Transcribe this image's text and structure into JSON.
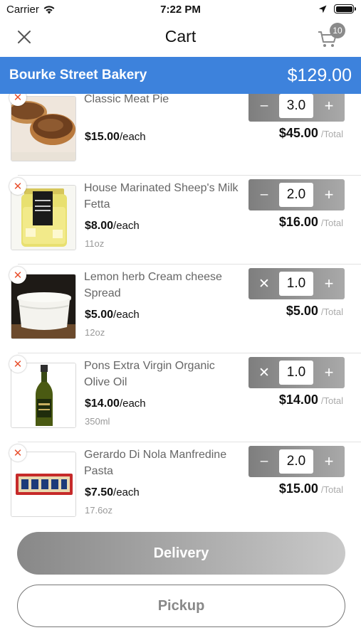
{
  "status_bar": {
    "carrier": "Carrier",
    "time": "7:22 PM"
  },
  "nav": {
    "title": "Cart",
    "cart_count": "10"
  },
  "store": {
    "name": "Bourke Street Bakery",
    "total": "$129.00"
  },
  "items": [
    {
      "name": "Classic Meat Pie",
      "price": "$15.00",
      "unit": "/each",
      "size": "",
      "qty": "3.0",
      "decrement_icon": "minus",
      "line_total": "$45.00",
      "total_label": "/Total",
      "image": "meat-pie"
    },
    {
      "name": "House Marinated Sheep's Milk Fetta",
      "price": "$8.00",
      "unit": "/each",
      "size": "11oz",
      "qty": "2.0",
      "decrement_icon": "minus",
      "line_total": "$16.00",
      "total_label": "/Total",
      "image": "fetta-jar"
    },
    {
      "name": "Lemon herb Cream cheese Spread",
      "price": "$5.00",
      "unit": "/each",
      "size": "12oz",
      "qty": "1.0",
      "decrement_icon": "remove",
      "line_total": "$5.00",
      "total_label": "/Total",
      "image": "cheese-tub"
    },
    {
      "name": "Pons Extra Virgin Organic Olive Oil",
      "price": "$14.00",
      "unit": "/each",
      "size": "350ml",
      "qty": "1.0",
      "decrement_icon": "remove",
      "line_total": "$14.00",
      "total_label": "/Total",
      "image": "olive-oil-bottle"
    },
    {
      "name": "Gerardo Di Nola Manfredine Pasta",
      "price": "$7.50",
      "unit": "/each",
      "size": "17.6oz",
      "qty": "2.0",
      "decrement_icon": "minus",
      "line_total": "$15.00",
      "total_label": "/Total",
      "image": "pasta-box"
    }
  ],
  "buttons": {
    "delivery": "Delivery",
    "pickup": "Pickup"
  },
  "colors": {
    "store_bar": "#3d82dc",
    "remove_x": "#e8502d"
  }
}
